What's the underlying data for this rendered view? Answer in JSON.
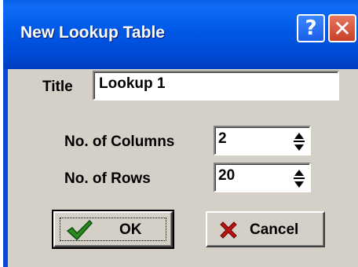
{
  "window": {
    "title": "New Lookup Table",
    "help_glyph": "?",
    "close_glyph": "✕"
  },
  "form": {
    "title_label": "Title",
    "title_value": "Lookup 1",
    "columns_label": "No. of Columns",
    "columns_value": "2",
    "rows_label": "No. of Rows",
    "rows_value": "20"
  },
  "buttons": {
    "ok_label": "OK",
    "cancel_label": "Cancel"
  },
  "icons": {
    "ok_icon": "checkmark-icon",
    "cancel_icon": "red-x-icon",
    "spin_icon": "spin-arrows-icon"
  },
  "colors": {
    "titlebar": "#0058e6",
    "dialog_bg": "#d4d0c8",
    "check_green": "#2a8a1f",
    "cancel_red": "#c01010"
  }
}
